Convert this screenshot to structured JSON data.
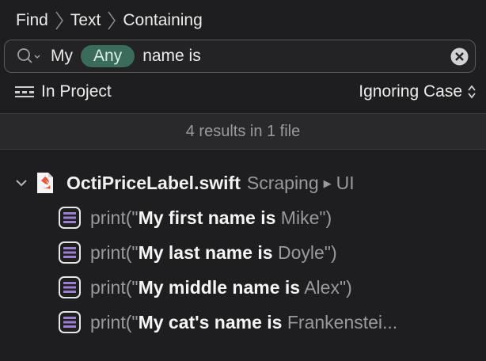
{
  "breadcrumb": [
    "Find",
    "Text",
    "Containing"
  ],
  "search": {
    "term_before": "My",
    "token": "Any",
    "term_after": "name is"
  },
  "options": {
    "scope_label": "In Project",
    "case_label": "Ignoring Case"
  },
  "summary": "4 results in 1 file",
  "file": {
    "name": "OctiPriceLabel.swift",
    "path": [
      "Scraping",
      "UI"
    ]
  },
  "results": [
    {
      "prefix": "print(\"",
      "match": "My first name is",
      "suffix": " Mike\")"
    },
    {
      "prefix": "print(\"",
      "match": "My last name is",
      "suffix": " Doyle\")"
    },
    {
      "prefix": "print(\"",
      "match": "My middle name is",
      "suffix": " Alex\")"
    },
    {
      "prefix": "print(\"",
      "match": "My cat's name is",
      "suffix": " Frankenstei..."
    }
  ],
  "colors": {
    "background": "#1e1e20",
    "token": "#3b6b5a",
    "swift": "#e9573f"
  },
  "icons": [
    "magnifying-glass-icon",
    "clear-icon",
    "scope-icon",
    "up-down-chevron-icon",
    "disclosure-chevron-icon",
    "swift-file-icon",
    "code-line-icon"
  ]
}
